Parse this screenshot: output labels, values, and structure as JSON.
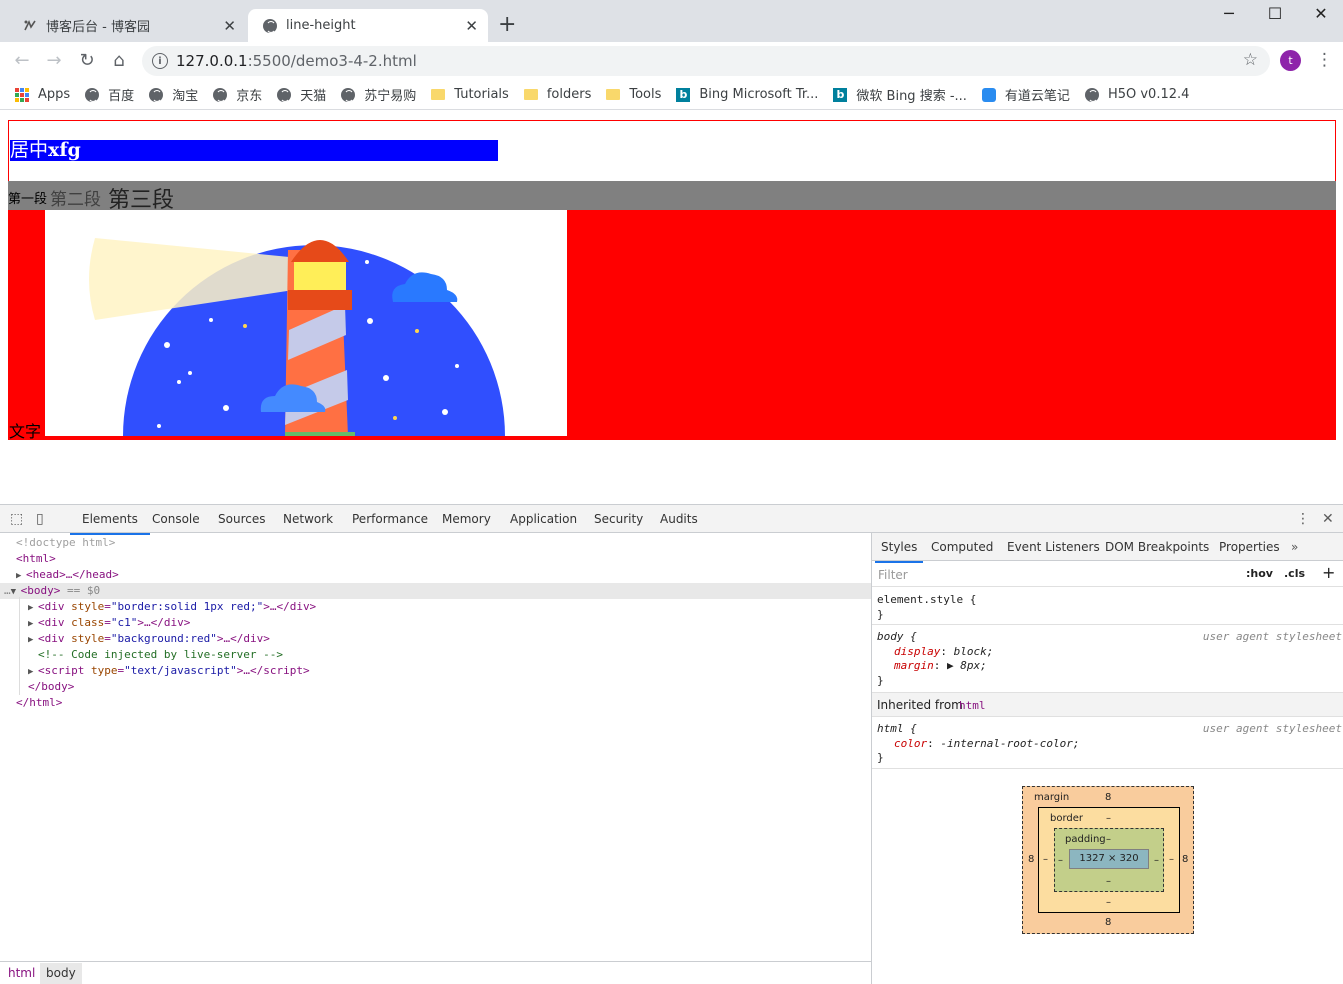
{
  "browser": {
    "tabs": [
      {
        "title": "博客后台 - 博客园",
        "active": false
      },
      {
        "title": "line-height",
        "active": true
      }
    ],
    "new_tab": "+",
    "window_controls": {
      "minimize": "─",
      "maximize": "☐",
      "close": "✕"
    },
    "url_host": "127.0.0.1",
    "url_path": ":5500/demo3-4-2.html",
    "avatar_letter": "t",
    "bookmarks": [
      {
        "label": "Apps",
        "icon": "apps-grid-icon"
      },
      {
        "label": "百度",
        "icon": "globe-icon"
      },
      {
        "label": "淘宝",
        "icon": "globe-icon"
      },
      {
        "label": "京东",
        "icon": "globe-icon"
      },
      {
        "label": "天猫",
        "icon": "globe-icon"
      },
      {
        "label": "苏宁易购",
        "icon": "globe-icon"
      },
      {
        "label": "Tutorials",
        "icon": "folder-icon"
      },
      {
        "label": "folders",
        "icon": "folder-icon"
      },
      {
        "label": "Tools",
        "icon": "folder-icon"
      },
      {
        "label": "Bing Microsoft Tr...",
        "icon": "bing-icon"
      },
      {
        "label": "微软 Bing 搜索 -...",
        "icon": "bing-icon"
      },
      {
        "label": "有道云笔记",
        "icon": "youdao-icon"
      },
      {
        "label": "H5O v0.12.4",
        "icon": "globe-icon"
      }
    ]
  },
  "page": {
    "center_text_cn": "居中",
    "center_text_en": "xfg",
    "para1": "第一段",
    "para2": "第二段",
    "para3": "第三段",
    "word_text": "文字"
  },
  "devtools": {
    "tabs": [
      "Elements",
      "Console",
      "Sources",
      "Network",
      "Performance",
      "Memory",
      "Application",
      "Security",
      "Audits"
    ],
    "dom": {
      "doctype": "<!doctype html>",
      "html_open": "<html>",
      "head": "<head>…</head>",
      "body_open": "<body>",
      "body_marker": "== $0",
      "div1_tag": "div",
      "div1_attr": "style",
      "div1_val": "\"border:solid 1px red;\"",
      "div2_tag": "div",
      "div2_attr": "class",
      "div2_val": "\"c1\"",
      "div3_tag": "div",
      "div3_attr": "style",
      "div3_val": "\"background:red\"",
      "comment": "<!-- Code injected by live-server -->",
      "script_tag": "script",
      "script_attr": "type",
      "script_val": "\"text/javascript\"",
      "body_close": "</body>",
      "html_close": "</html>"
    },
    "breadcrumbs": [
      "html",
      "body"
    ],
    "styles_tabs": [
      "Styles",
      "Computed",
      "Event Listeners",
      "DOM Breakpoints",
      "Properties"
    ],
    "filter_placeholder": "Filter",
    "hov": ":hov",
    "cls": ".cls",
    "rules": {
      "element_style": "element.style {",
      "close": "}",
      "body_selector": "body {",
      "ua": "user agent stylesheet",
      "body_prop1": "display",
      "body_val1": "block;",
      "body_prop2": "margin",
      "body_val2": "8px;",
      "inherited_label": "Inherited from",
      "inherited_from": "html",
      "html_selector": "html {",
      "html_prop": "color",
      "html_val": "-internal-root-color;"
    },
    "box_model": {
      "margin_label": "margin",
      "margin_top": "8",
      "margin_left": "8",
      "margin_right": "8",
      "margin_bottom": "8",
      "border_label": "border",
      "border_value": "–",
      "padding_label": "padding",
      "padding_value": "–",
      "content": "1327 × 320"
    }
  },
  "colors": {
    "blue_box": "#0000ff",
    "gray_band": "#808080",
    "red_band": "#ff0000",
    "accent": "#1a73e8"
  }
}
